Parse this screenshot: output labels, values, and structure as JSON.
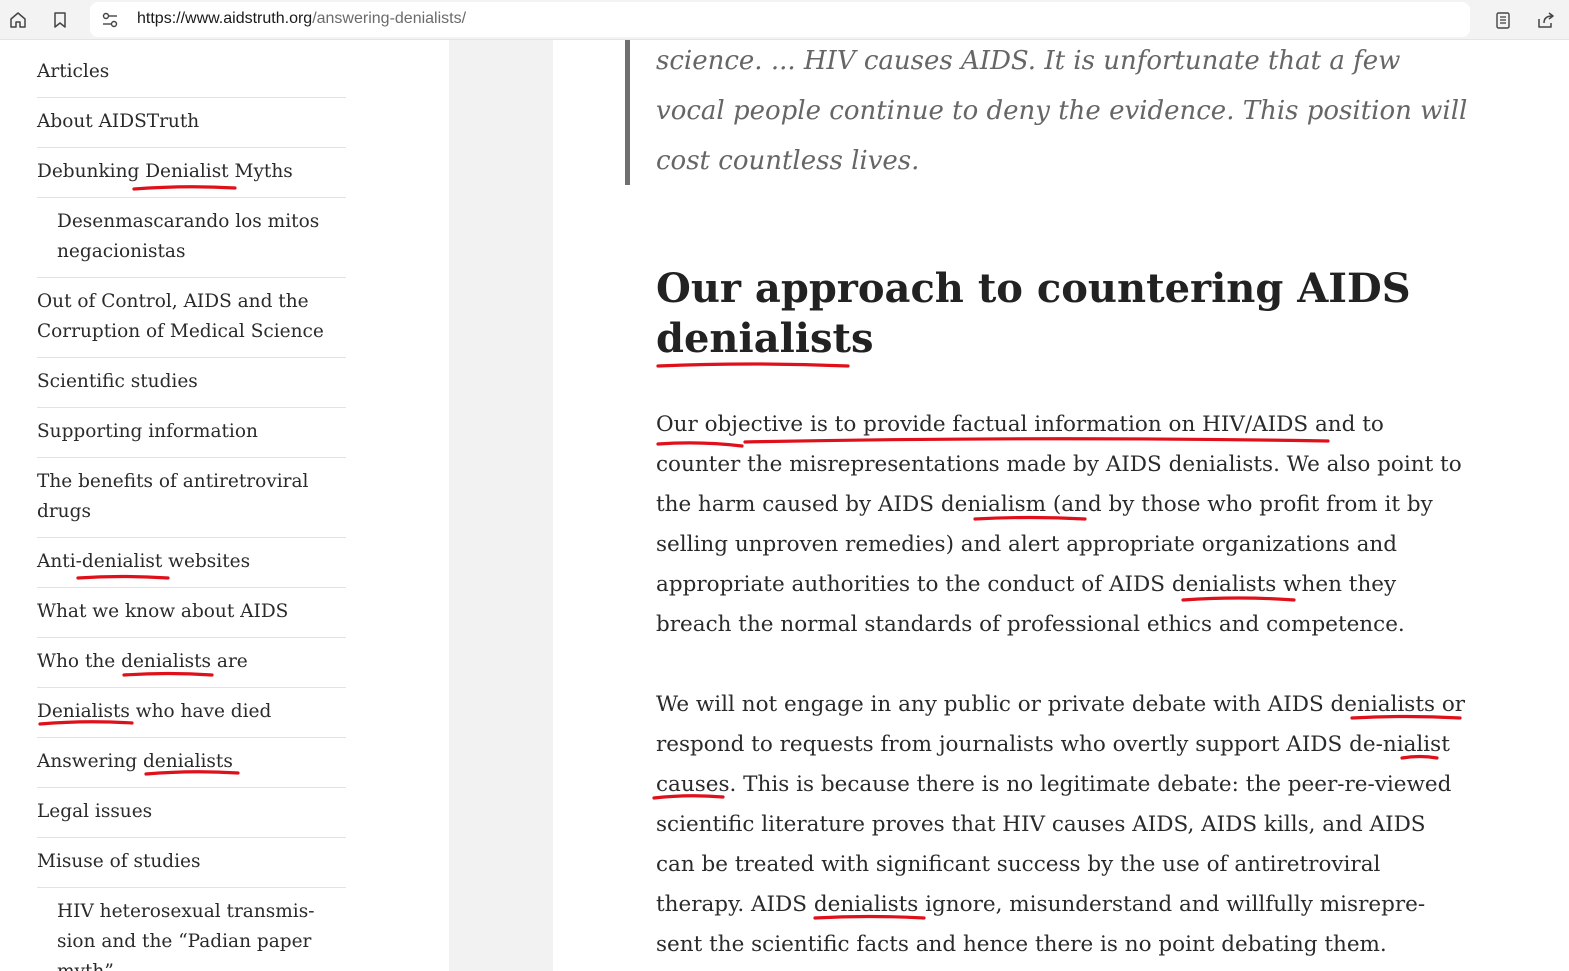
{
  "browser": {
    "url_host": "https://www.aidstruth.org",
    "url_path": "/answering-denialists/",
    "icons": [
      "home-icon",
      "bookmark-icon",
      "site-settings-icon",
      "reader-mode-icon",
      "share-icon"
    ]
  },
  "sidebar": {
    "items": [
      {
        "label": "Articles",
        "sub": false
      },
      {
        "label": "About AIDSTruth",
        "sub": false
      },
      {
        "label": "Debunking Denialist Myths",
        "sub": false
      },
      {
        "label": "Desenmascarando los mitos negacionistas",
        "sub": true
      },
      {
        "label": "Out of Control, AIDS and the Corruption of Medical Science",
        "sub": false
      },
      {
        "label": "Scientific studies",
        "sub": false
      },
      {
        "label": "Supporting information",
        "sub": false
      },
      {
        "label": "The benefits of antiretroviral drugs",
        "sub": false
      },
      {
        "label": "Anti-denialist websites",
        "sub": false
      },
      {
        "label": "What we know about AIDS",
        "sub": false
      },
      {
        "label": "Who the denialists are",
        "sub": false
      },
      {
        "label": "Denialists who have died",
        "sub": false
      },
      {
        "label": "Answering denialists",
        "sub": false
      },
      {
        "label": "Legal issues",
        "sub": false
      },
      {
        "label": "Misuse of studies",
        "sub": false
      },
      {
        "label": "HIV heterosexual transmis-sion and the “Padian paper myth”",
        "sub": true
      }
    ]
  },
  "main": {
    "quote": "science. ... HIV causes AIDS. It is unfortunate that a few vocal people continue to deny the evidence. This position will cost countless lives.",
    "heading": "Our approach to countering AIDS denialists",
    "paragraphs": [
      "Our objective is to provide factual information on HIV/AIDS and to counter the misrepresentations made by AIDS denialists. We also point to the harm caused by AIDS denialism (and by those who profit from it by selling unproven remedies) and alert appropriate organizations and appropriate authorities to the conduct of AIDS denialists when they breach the normal standards of professional ethics and competence.",
      "We will not engage in any public or private debate with AIDS denialists or respond to requests from journalists who overtly support AIDS de-nialist causes. This is because there is no legitimate debate: the peer-re-viewed scientific literature proves that HIV causes AIDS, AIDS kills, and AIDS can be treated with significant success by the use of antiretroviral therapy. AIDS denialists ignore, misunderstand and willfully misrepre-sent the scientific facts and hence there is no point debating them."
    ]
  },
  "colors": {
    "spellcheck": "#e0101b",
    "gutter": "#f2f2f2",
    "quote_text": "#666666",
    "quote_bar": "#707070"
  }
}
